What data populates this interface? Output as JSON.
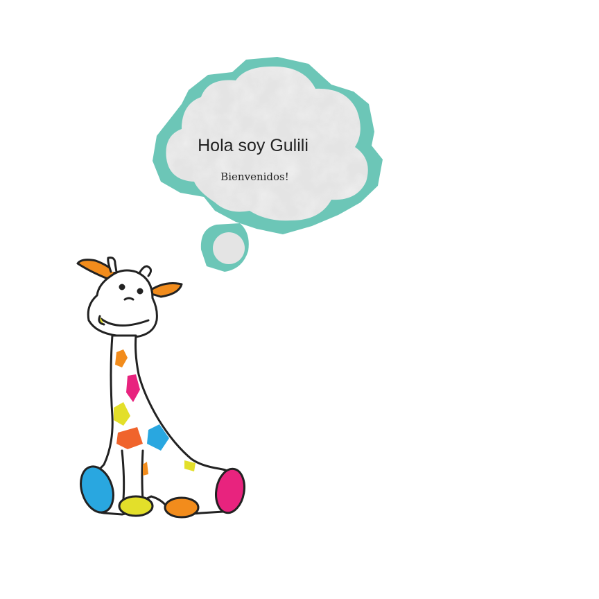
{
  "bubble": {
    "title": "Hola soy Gulili",
    "subtitle": "Bienvenidos!"
  },
  "colors": {
    "bubble_outline": "#6cc6b7",
    "bubble_fill": "#e6e6e6",
    "spot_orange": "#f28c1c",
    "spot_red_orange": "#f0642c",
    "spot_pink": "#e8237e",
    "spot_blue": "#29a7e0",
    "spot_yellow": "#e3df2a",
    "outline": "#222222"
  },
  "icons": {
    "character": "giraffe-icon",
    "thought": "thought-bubble-icon"
  }
}
